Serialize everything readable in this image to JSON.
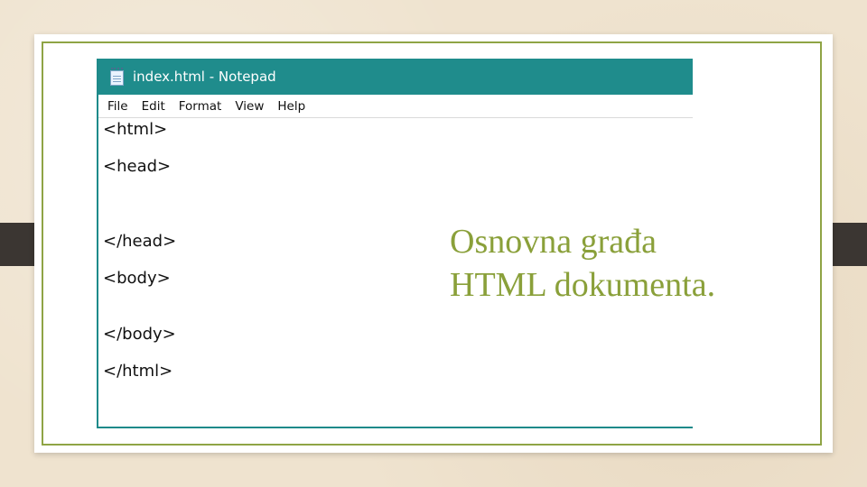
{
  "notepad": {
    "title": "index.html - Notepad",
    "menu": [
      "File",
      "Edit",
      "Format",
      "View",
      "Help"
    ],
    "code_lines": [
      "<html>",
      "<head>",
      "</head>",
      "<body>",
      "</body>",
      "</html>"
    ]
  },
  "slide": {
    "title_line1": "Osnovna građa",
    "title_line2": "HTML dokumenta."
  },
  "colors": {
    "background": "#efe3cf",
    "accent_green": "#8aa03a",
    "titlebar_teal": "#1f8c8c",
    "tab_dark": "#3b3632"
  }
}
